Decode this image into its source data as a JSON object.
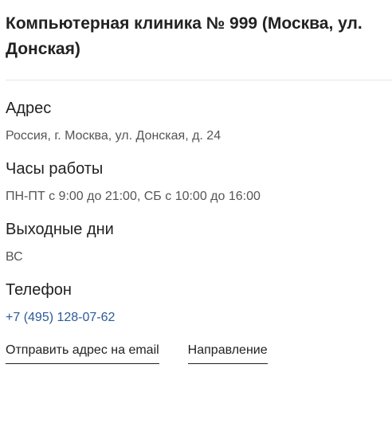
{
  "title": "Компьютерная клиника № 999 (Москва, ул. Донская)",
  "sections": [
    {
      "heading": "Адрес",
      "value": "Россия, г. Москва, ул. Донская, д. 24"
    },
    {
      "heading": "Часы работы",
      "value": "ПН-ПТ с 9:00 до 21:00, СБ с 10:00 до 16:00"
    },
    {
      "heading": "Выходные дни",
      "value": "ВС"
    },
    {
      "heading": "Телефон",
      "value": "+7 (495) 128-07-62"
    }
  ],
  "links": {
    "email_label": "Отправить адрес на email",
    "directions_label": "Направление"
  },
  "colors": {
    "text": "#222222",
    "muted": "#555555",
    "link": "#2b5a99",
    "divider": "#e6e6e6"
  }
}
